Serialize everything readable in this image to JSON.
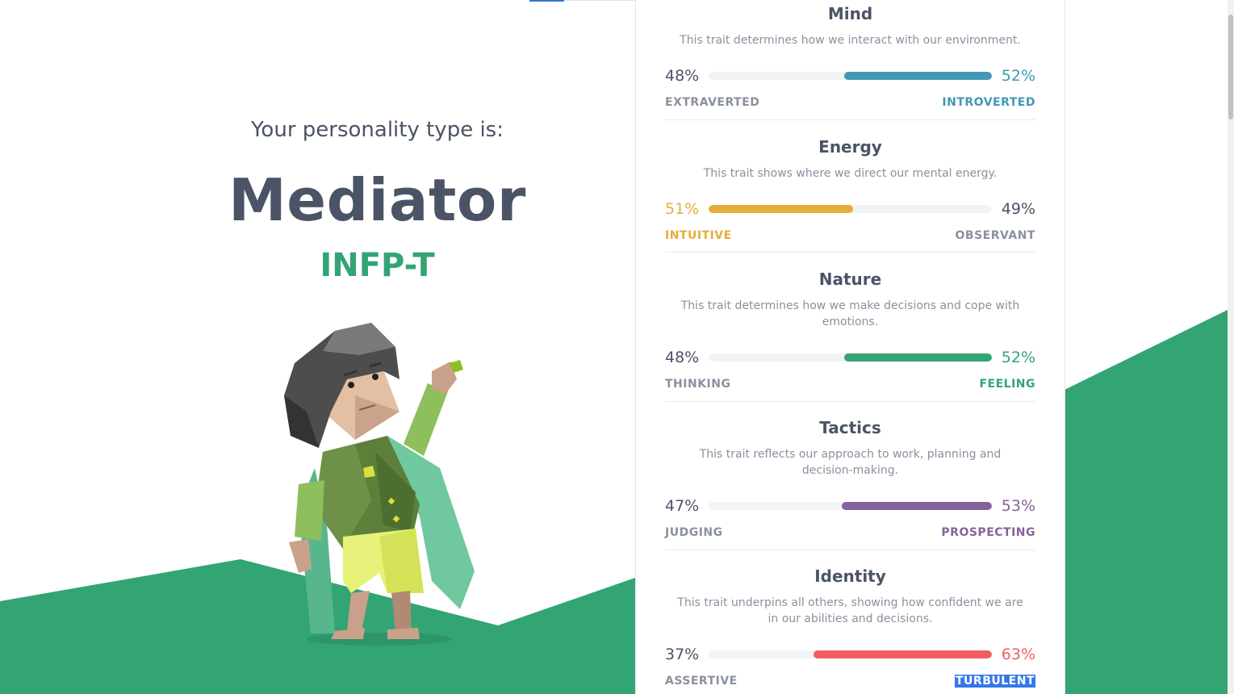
{
  "hero": {
    "label": "Your personality type is:",
    "type_name": "Mediator",
    "type_code": "INFP-T"
  },
  "colors": {
    "green": "#33a474",
    "mind": "#4298b4",
    "energy": "#e4ae3a",
    "nature": "#33a474",
    "tactics": "#88619a",
    "identity": "#f25e62",
    "text": "#4b5366",
    "muted": "#8a919e"
  },
  "traits": [
    {
      "title": "Mind",
      "description": "This trait determines how we interact with our environment.",
      "left_pct": "48%",
      "right_pct": "52%",
      "left_label": "EXTRAVERTED",
      "right_label": "INTROVERTED",
      "dominant": "right",
      "value": 52,
      "color": "#4298b4"
    },
    {
      "title": "Energy",
      "description": "This trait shows where we direct our mental energy.",
      "left_pct": "51%",
      "right_pct": "49%",
      "left_label": "INTUITIVE",
      "right_label": "OBSERVANT",
      "dominant": "left",
      "value": 51,
      "color": "#e4ae3a"
    },
    {
      "title": "Nature",
      "description": "This trait determines how we make decisions and cope with emotions.",
      "left_pct": "48%",
      "right_pct": "52%",
      "left_label": "THINKING",
      "right_label": "FEELING",
      "dominant": "right",
      "value": 52,
      "color": "#33a474"
    },
    {
      "title": "Tactics",
      "description": "This trait reflects our approach to work, planning and decision-making.",
      "left_pct": "47%",
      "right_pct": "53%",
      "left_label": "JUDGING",
      "right_label": "PROSPECTING",
      "dominant": "right",
      "value": 53,
      "color": "#88619a"
    },
    {
      "title": "Identity",
      "description": "This trait underpins all others, showing how confident we are in our abilities and decisions.",
      "left_pct": "37%",
      "right_pct": "63%",
      "left_label": "ASSERTIVE",
      "right_label": "TURBULENT",
      "dominant": "right",
      "value": 63,
      "color": "#f25e62"
    }
  ]
}
